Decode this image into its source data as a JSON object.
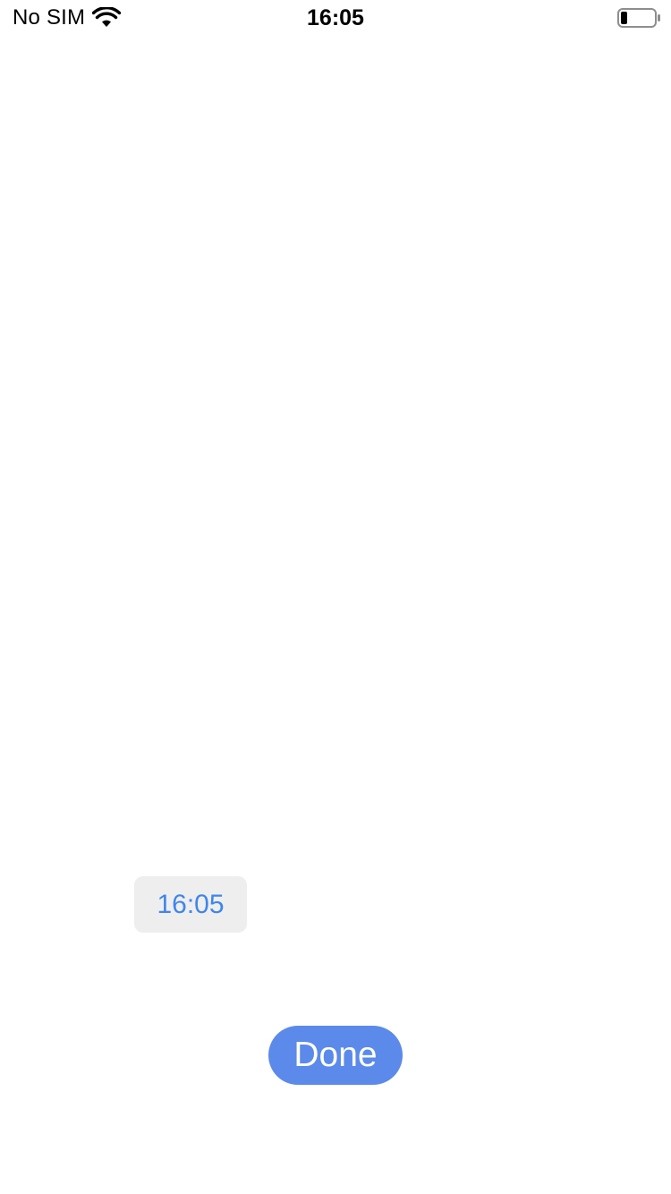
{
  "status_bar": {
    "carrier": "No SIM",
    "time": "16:05",
    "wifi_icon": "wifi-icon",
    "battery_icon": "battery-low-icon",
    "battery_level": 0.15
  },
  "picker": {
    "time_value": "16:05",
    "text_color": "#3f86ea",
    "background_color": "#eeeeef"
  },
  "actions": {
    "done_label": "Done",
    "done_color": "#5b8aea"
  }
}
